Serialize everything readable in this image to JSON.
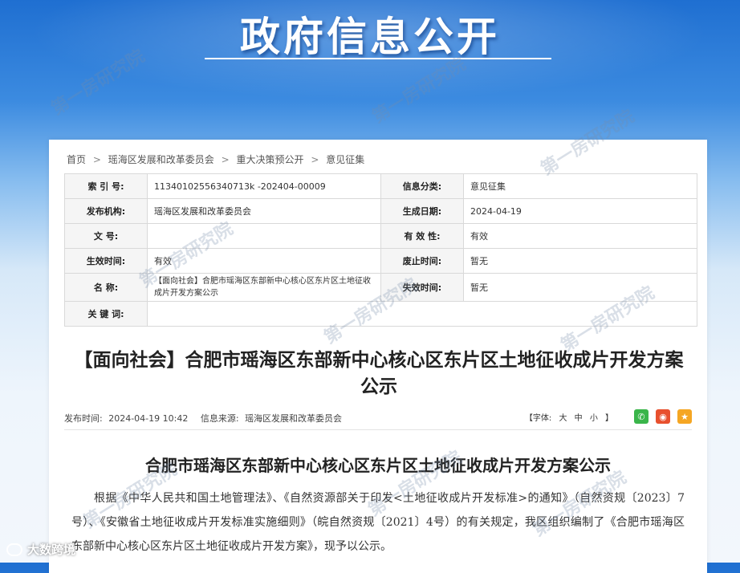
{
  "banner": {
    "title": "政府信息公开"
  },
  "breadcrumb": [
    "首页",
    "瑶海区发展和改革委员会",
    "重大决策预公开",
    "意见征集"
  ],
  "breadcrumb_sep": ">",
  "meta": {
    "index_label": "索 引 号:",
    "index_value": "11340102556340713k -202404-00009",
    "category_label": "信息分类:",
    "category_value": "意见征集",
    "publisher_label": "发布机构:",
    "publisher_value": "瑶海区发展和改革委员会",
    "created_label": "生成日期:",
    "created_value": "2024-04-19",
    "docno_label": "文 号:",
    "docno_value": "",
    "validity_label": "有 效 性:",
    "validity_value": "有效",
    "effective_label": "生效时间:",
    "effective_value": "有效",
    "abolish_label": "废止时间:",
    "abolish_value": "暂无",
    "name_label": "名 称:",
    "name_value": "【面向社会】合肥市瑶海区东部新中心核心区东片区土地征收成片开发方案公示",
    "expire_label": "失效时间:",
    "expire_value": "暂无",
    "keywords_label": "关 键 词:",
    "keywords_value": ""
  },
  "article": {
    "title": "【面向社会】合肥市瑶海区东部新中心核心区东片区土地征收成片开发方案公示",
    "publish_time_label": "发布时间:",
    "publish_time": "2024-04-19 10:42",
    "source_label": "信息来源:",
    "source": "瑶海区发展和改革委员会",
    "font_size_label": "【字体:",
    "font_large": "大",
    "font_medium": "中",
    "font_small": "小",
    "font_close": "】",
    "subtitle": "合肥市瑶海区东部新中心核心区东片区土地征收成片开发方案公示",
    "body": "根据《中华人民共和国土地管理法》、《自然资源部关于印发<土地征收成片开发标准>的通知》（自然资规〔2023〕7号）、《安徽省土地征收成片开发标准实施细则》（皖自然资规〔2021〕4号）的有关规定，我区组织编制了《合肥市瑶海区东部新中心核心区东片区土地征收成片开发方案》，现予以公示。"
  },
  "share": [
    {
      "name": "wechat-icon",
      "color": "#3ab54a",
      "glyph": "✆"
    },
    {
      "name": "weibo-icon",
      "color": "#e8502e",
      "glyph": "◉"
    },
    {
      "name": "star-icon",
      "color": "#f5a623",
      "glyph": "★"
    }
  ],
  "watermark": "第一房研究院",
  "corner_logo": "大数跨境"
}
